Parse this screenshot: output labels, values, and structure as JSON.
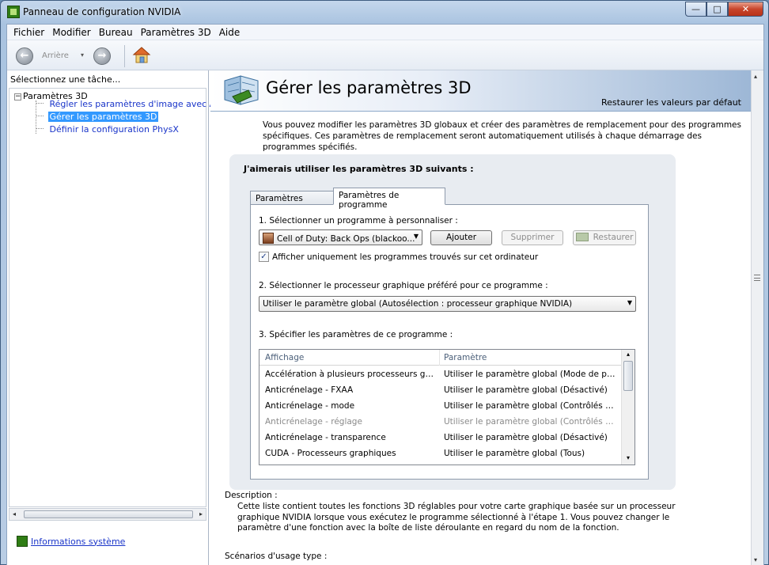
{
  "window": {
    "title": "Panneau de configuration NVIDIA",
    "minimize_glyph": "—",
    "maximize_glyph": "□",
    "close_glyph": "✕"
  },
  "menu": [
    "Fichier",
    "Modifier",
    "Bureau",
    "Paramètres 3D",
    "Aide"
  ],
  "toolbar": {
    "back_label": "Arrière",
    "back_glyph": "←",
    "forward_glyph": "→",
    "dropdown_glyph": "▾"
  },
  "sidebar": {
    "header": "Sélectionnez une tâche...",
    "root": "Paramètres 3D",
    "root_toggle": "−",
    "items": [
      "Régler les paramètres d'image avec Aperç",
      "Gérer les paramètres 3D",
      "Définir la configuration PhysX"
    ],
    "selected_index": 1,
    "scroll_left": "◂",
    "scroll_right": "▸",
    "system_info": "Informations système"
  },
  "main": {
    "title": "Gérer les paramètres 3D",
    "restore_link": "Restaurer les valeurs par défaut",
    "intro": "Vous pouvez modifier les paramètres 3D globaux et créer des paramètres de remplacement pour des programmes spécifiques. Ces paramètres de remplacement seront automatiquement utilisés à chaque démarrage des programmes spécifiés.",
    "group_title": "J'aimerais utiliser les paramètres 3D suivants :",
    "tabs": [
      "Paramètres globaux",
      "Paramètres de programme"
    ],
    "step1": "1. Sélectionner un programme à personnaliser :",
    "program_value": "Cell of Duty: Back Ops (blackoo...",
    "add_button": "Ajouter",
    "remove_button": "Supprimer",
    "restore_button": "Restaurer",
    "checkbox_label": "Afficher uniquement les programmes trouvés sur cet ordinateur",
    "checkbox_mark": "✓",
    "step2": "2. Sélectionner le processeur graphique préféré pour ce programme :",
    "gpu_value": "Utiliser le paramètre global (Autosélection : processeur graphique NVIDIA)",
    "step3": "3. Spécifier les paramètres de ce programme :",
    "list_headers": [
      "Affichage",
      "Paramètre"
    ],
    "list_rows": [
      {
        "feature": "Accélération à plusieurs processeurs grap...",
        "setting": "Utiliser le paramètre global (Mode de perfo...",
        "dim": false
      },
      {
        "feature": "Anticrénelage - FXAA",
        "setting": "Utiliser le paramètre global (Désactivé)",
        "dim": false
      },
      {
        "feature": "Anticrénelage - mode",
        "setting": "Utiliser le paramètre global (Contrôlés par l...",
        "dim": false
      },
      {
        "feature": "Anticrénelage - réglage",
        "setting": "Utiliser le paramètre global (Contrôlés par l...",
        "dim": true
      },
      {
        "feature": "Anticrénelage - transparence",
        "setting": "Utiliser le paramètre global (Désactivé)",
        "dim": false
      },
      {
        "feature": "CUDA - Processeurs graphiques",
        "setting": "Utiliser le paramètre global (Tous)",
        "dim": false
      }
    ],
    "list_scroll_up": "▴",
    "list_scroll_down": "▾",
    "combo_arrow": "▼",
    "description_title": "Description :",
    "description_text": "Cette liste contient toutes les fonctions 3D réglables pour votre carte graphique basée sur un processeur graphique NVIDIA lorsque vous exécutez le programme sélectionné à l'étape 1. Vous pouvez changer le paramètre d'une fonction avec la boîte de liste déroulante en regard du nom de la fonction.",
    "scenarios_title": "Scénarios d'usage type :",
    "scroll_up": "▴",
    "scroll_down": "▾"
  },
  "colors": {
    "selection": "#3399ff",
    "link": "#1a35c9",
    "nvidia_green": "#2f7d14"
  }
}
